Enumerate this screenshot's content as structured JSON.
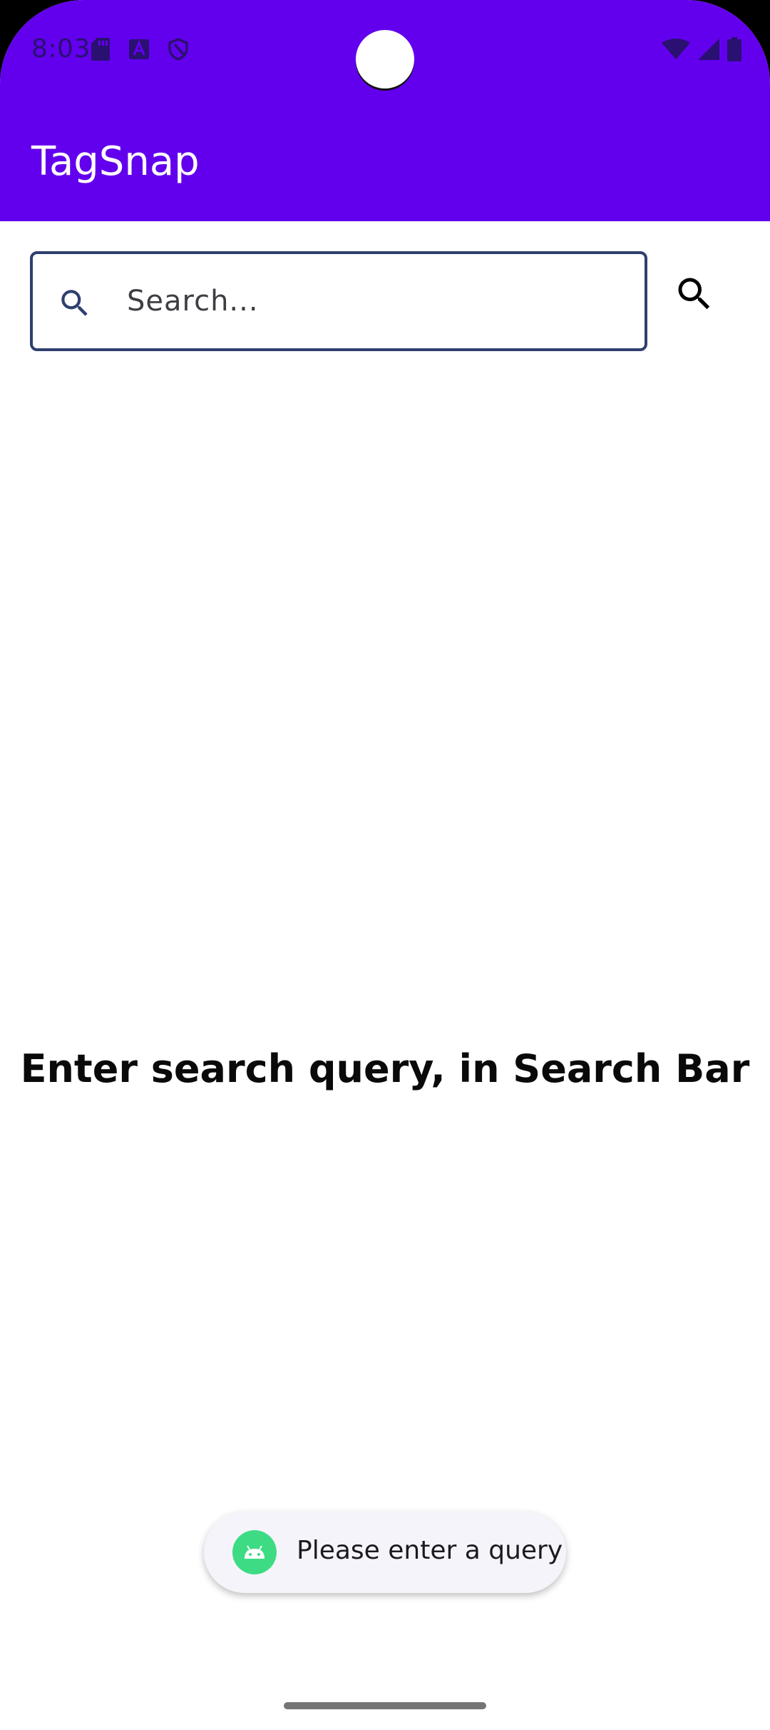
{
  "status_bar": {
    "time": "8:03",
    "left_icons": [
      "sd-card-icon",
      "font-a-icon",
      "shield-icon"
    ],
    "right_icons": [
      "wifi-icon",
      "signal-icon",
      "battery-icon"
    ]
  },
  "app_bar": {
    "title": "TagSnap"
  },
  "search": {
    "placeholder": "Search...",
    "value": "",
    "leading_icon": "search-icon",
    "action_icon": "search-icon"
  },
  "main": {
    "empty_message": "Enter search query, in Search Bar"
  },
  "toast": {
    "icon": "android-icon",
    "text": "Please enter a query"
  },
  "colors": {
    "app_bar": "#6200EE",
    "search_border": "#2f3f6e",
    "toast_bg": "#f6f4fb",
    "android_green": "#3ddc84"
  }
}
